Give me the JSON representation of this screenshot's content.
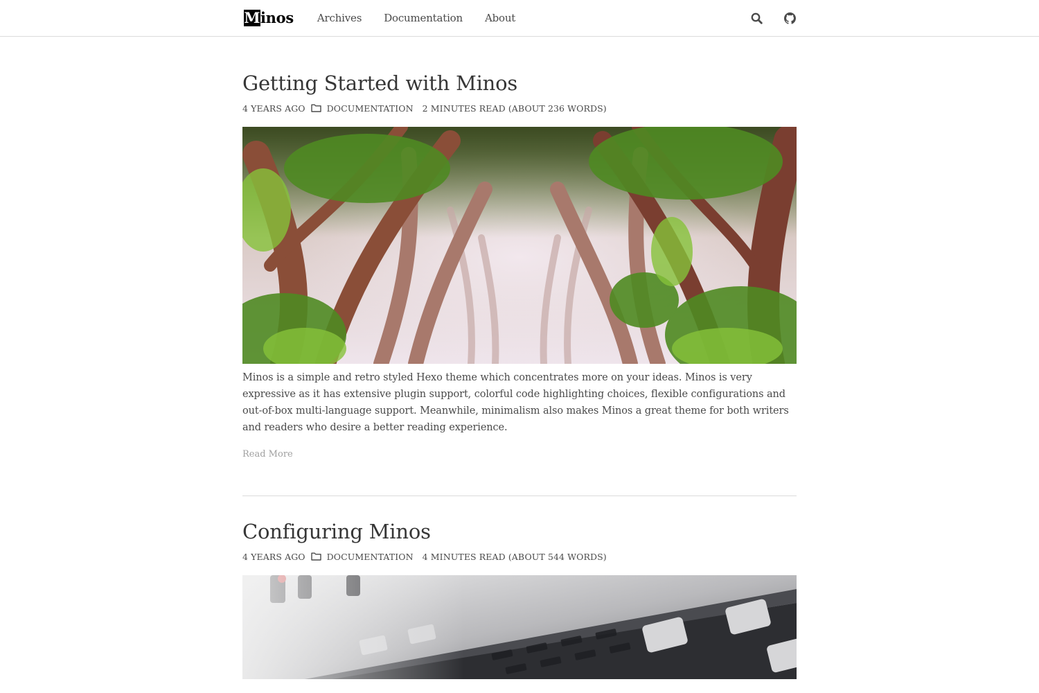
{
  "navbar": {
    "brand_initial": "M",
    "brand_rest": "inos",
    "links": [
      "Archives",
      "Documentation",
      "About"
    ],
    "icons": [
      "search-icon",
      "github-icon"
    ]
  },
  "posts": [
    {
      "title": "Getting Started with Minos",
      "date": "4 years ago",
      "category": "Documentation",
      "reading": "2 minutes read (About 236 words)",
      "thumbnail": "forest-tree-tunnel",
      "excerpt": "Minos is a simple and retro styled Hexo theme which concentrates more on your ideas. Minos is very expressive as it has extensive plugin support, colorful code highlighting choices, flexible configurations and out-of-box multi-language support. Meanwhile, minimalism also makes Minos a great theme for both writers and readers who desire a better reading experience.",
      "read_more": "Read More"
    },
    {
      "title": "Configuring Minos",
      "date": "4 years ago",
      "category": "Documentation",
      "reading": "4 minutes read (About 544 words)",
      "thumbnail": "audio-mixer-faders"
    }
  ],
  "colors": {
    "text": "#363636",
    "meta": "#4a4a4a",
    "muted": "#a0a0a0",
    "border": "#dbdbdb"
  }
}
